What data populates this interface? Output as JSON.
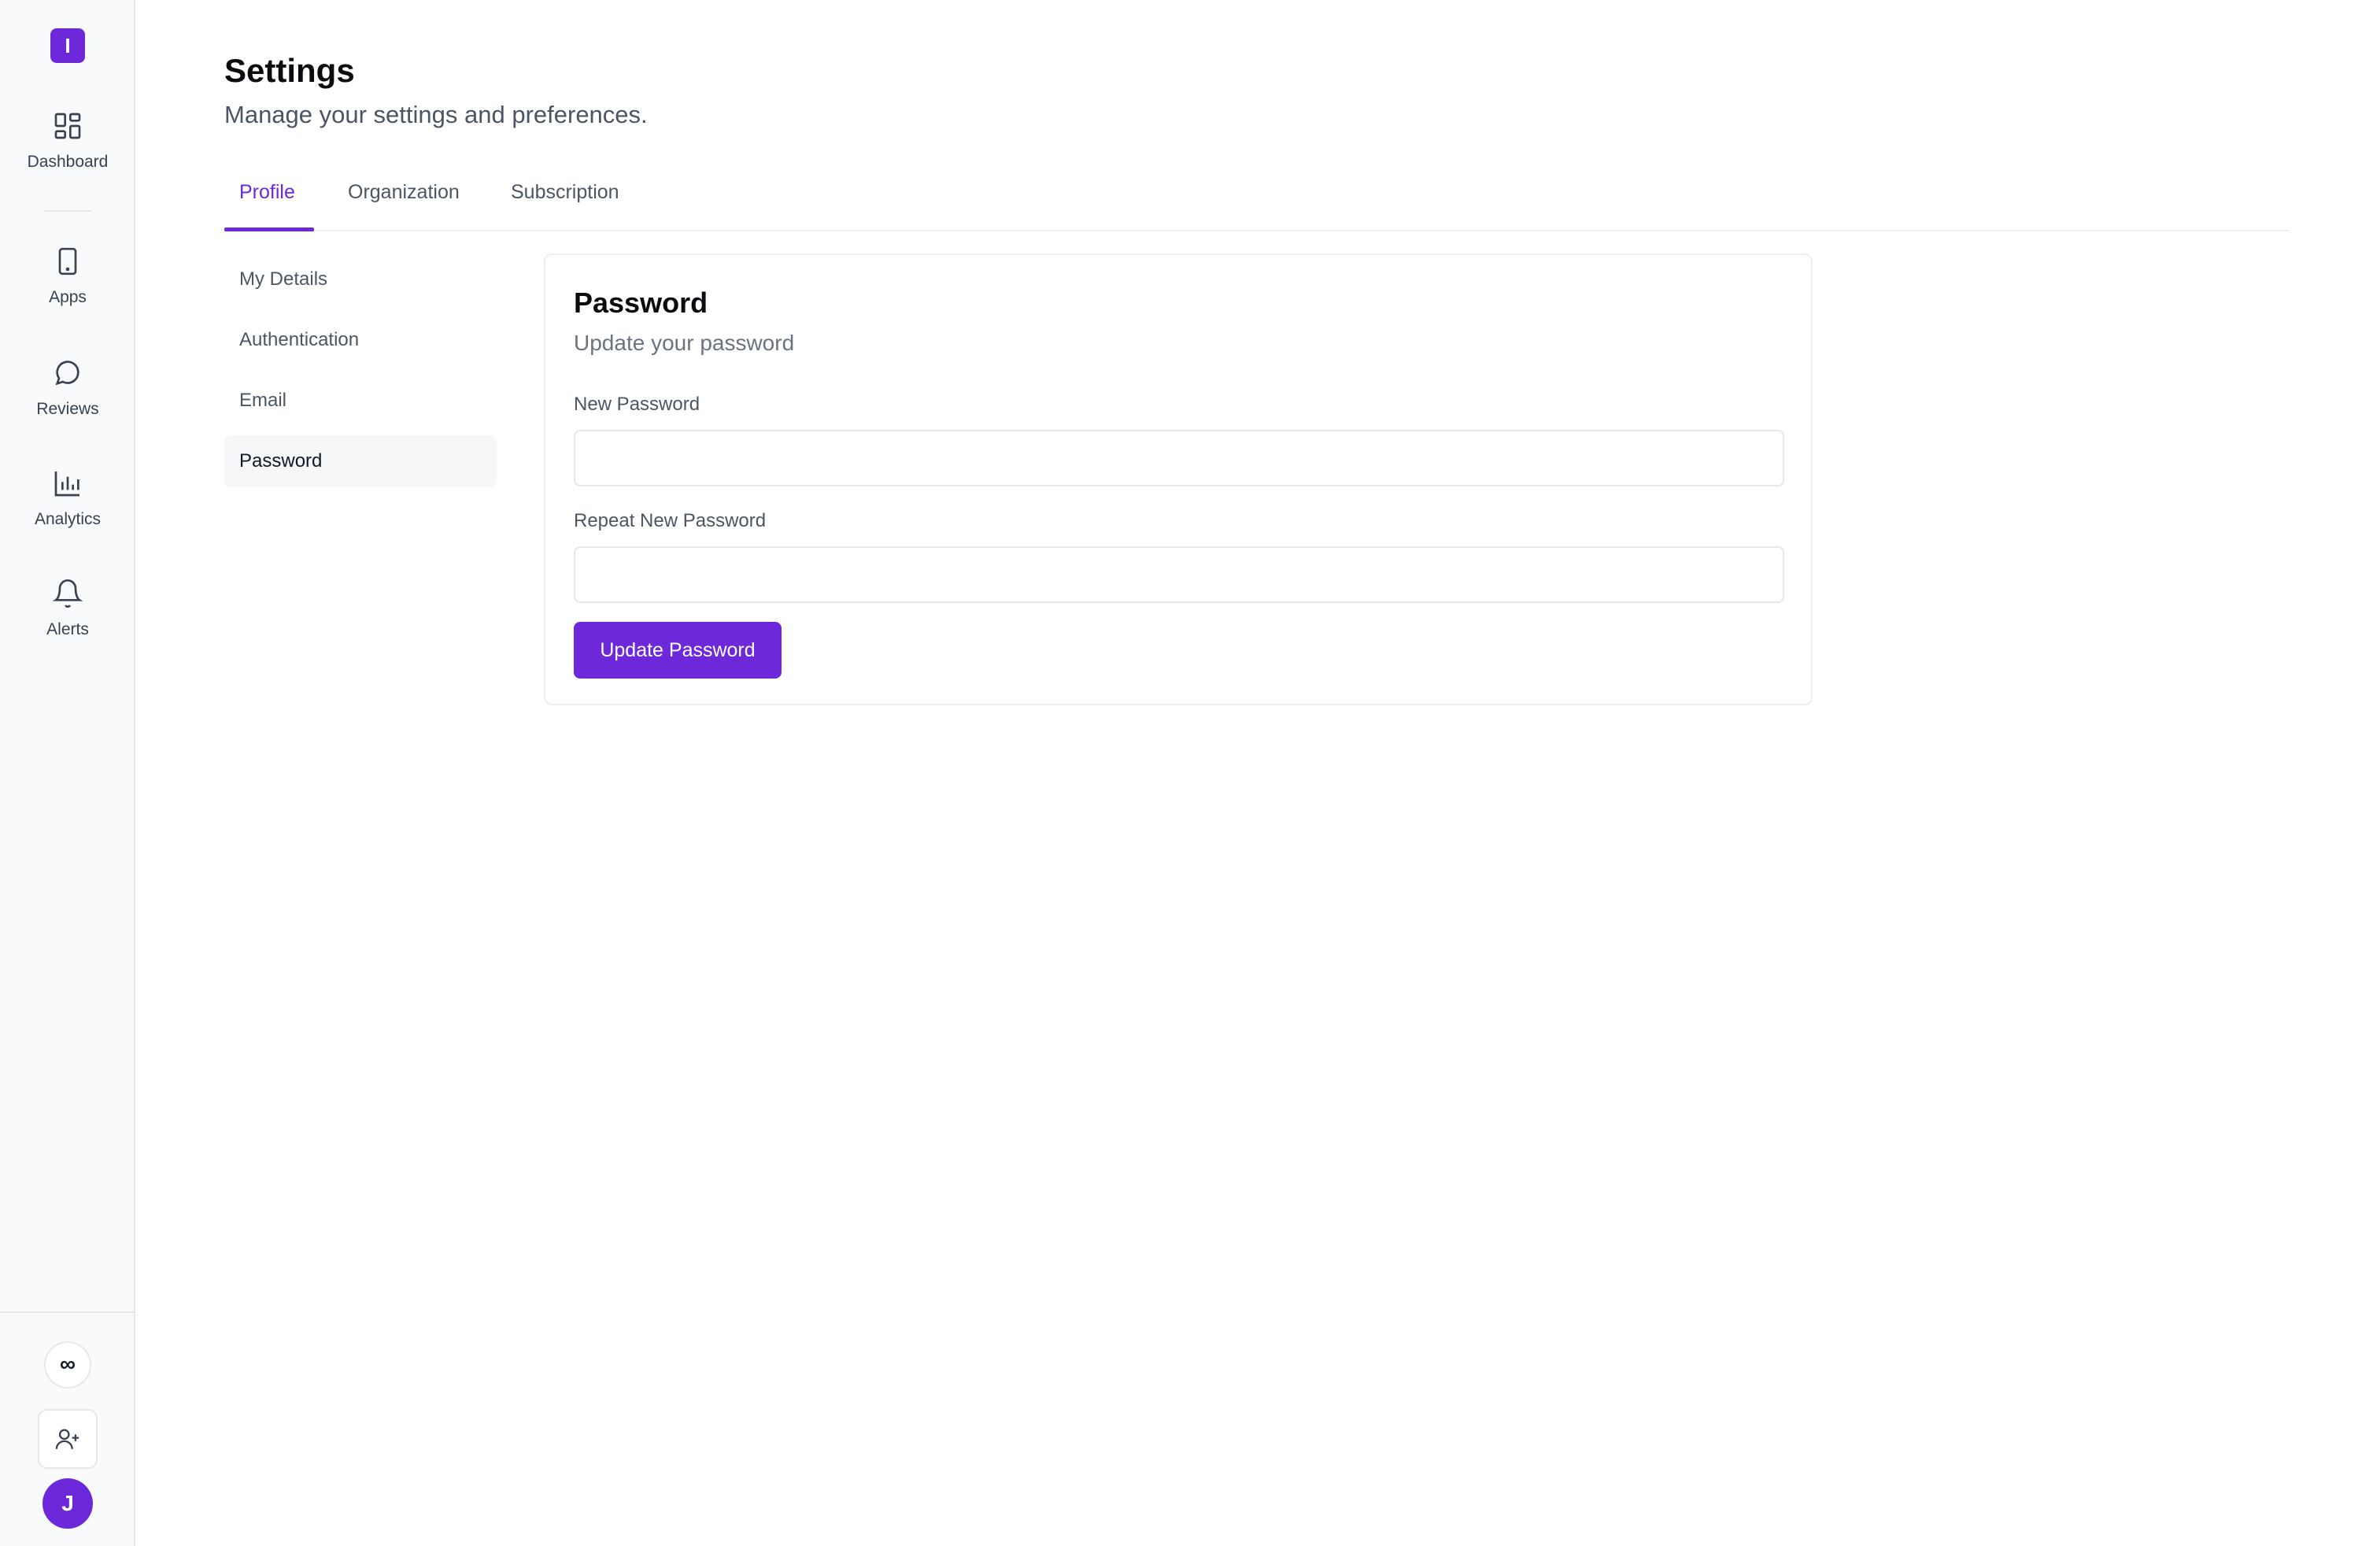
{
  "app": {
    "logo_letter": "I"
  },
  "sidebar": {
    "items": [
      {
        "label": "Dashboard",
        "icon": "dashboard-grid-icon"
      },
      {
        "label": "Apps",
        "icon": "tablet-icon"
      },
      {
        "label": "Reviews",
        "icon": "chat-bubble-icon"
      },
      {
        "label": "Analytics",
        "icon": "bar-chart-icon"
      },
      {
        "label": "Alerts",
        "icon": "bell-icon"
      }
    ],
    "bottom": {
      "infinity_label": "∞",
      "add_user_icon": "user-plus-icon",
      "avatar_letter": "J"
    }
  },
  "header": {
    "title": "Settings",
    "subtitle": "Manage your settings and preferences."
  },
  "tabs": [
    {
      "label": "Profile",
      "active": true
    },
    {
      "label": "Organization",
      "active": false
    },
    {
      "label": "Subscription",
      "active": false
    }
  ],
  "subnav": [
    {
      "label": "My Details",
      "active": false
    },
    {
      "label": "Authentication",
      "active": false
    },
    {
      "label": "Email",
      "active": false
    },
    {
      "label": "Password",
      "active": true
    }
  ],
  "password_card": {
    "title": "Password",
    "subtitle": "Update your password",
    "new_password_label": "New Password",
    "new_password_value": "",
    "repeat_password_label": "Repeat New Password",
    "repeat_password_value": "",
    "submit_label": "Update Password"
  },
  "colors": {
    "accent": "#6d28d9",
    "sidebar_bg": "#f9fafb",
    "text_muted": "#4b5563"
  }
}
